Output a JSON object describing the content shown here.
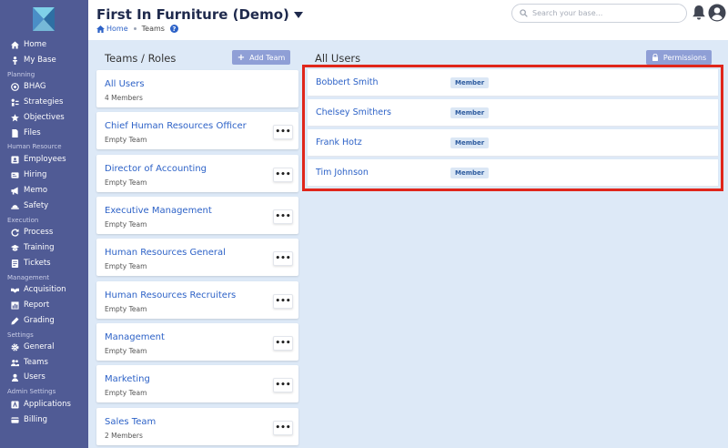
{
  "header": {
    "app_title": "First In Furniture (Demo)",
    "breadcrumb_home": "Home",
    "breadcrumb_current": "Teams",
    "help": "?",
    "search_placeholder": "Search your base..."
  },
  "sidebar": {
    "items": [
      {
        "label": "Home",
        "icon": "home-icon"
      },
      {
        "label": "My Base",
        "icon": "person-icon"
      }
    ],
    "section_planning": "Planning",
    "planning": [
      {
        "label": "BHAG",
        "icon": "target-icon"
      },
      {
        "label": "Strategies",
        "icon": "strategy-icon"
      },
      {
        "label": "Objectives",
        "icon": "star-icon"
      },
      {
        "label": "Files",
        "icon": "file-icon"
      }
    ],
    "section_hr": "Human Resource",
    "hr": [
      {
        "label": "Employees",
        "icon": "id-card-icon"
      },
      {
        "label": "Hiring",
        "icon": "hiring-icon"
      },
      {
        "label": "Memo",
        "icon": "megaphone-icon"
      },
      {
        "label": "Safety",
        "icon": "hardhat-icon"
      }
    ],
    "section_execution": "Execution",
    "execution": [
      {
        "label": "Process",
        "icon": "refresh-icon"
      },
      {
        "label": "Training",
        "icon": "graduation-cap-icon"
      },
      {
        "label": "Tickets",
        "icon": "ticket-icon"
      }
    ],
    "section_management": "Management",
    "management": [
      {
        "label": "Acquisition",
        "icon": "handshake-icon"
      },
      {
        "label": "Report",
        "icon": "report-icon"
      },
      {
        "label": "Grading",
        "icon": "pen-icon"
      }
    ],
    "section_settings": "Settings",
    "settings": [
      {
        "label": "General",
        "icon": "gear-icon"
      },
      {
        "label": "Teams",
        "icon": "users-icon"
      },
      {
        "label": "Users",
        "icon": "user-icon"
      }
    ],
    "section_admin": "Admin Settings",
    "admin": [
      {
        "label": "Applications",
        "icon": "apps-icon"
      },
      {
        "label": "Billing",
        "icon": "billing-icon"
      }
    ]
  },
  "teams_panel": {
    "title": "Teams / Roles",
    "add_button": "Add Team",
    "teams": [
      {
        "name": "All Users",
        "sub": "4 Members"
      },
      {
        "name": "Chief Human Resources Officer",
        "sub": "Empty Team"
      },
      {
        "name": "Director of Accounting",
        "sub": "Empty Team"
      },
      {
        "name": "Executive Management",
        "sub": "Empty Team"
      },
      {
        "name": "Human Resources General",
        "sub": "Empty Team"
      },
      {
        "name": "Human Resources Recruiters",
        "sub": "Empty Team"
      },
      {
        "name": "Management",
        "sub": "Empty Team"
      },
      {
        "name": "Marketing",
        "sub": "Empty Team"
      },
      {
        "name": "Sales Team",
        "sub": "2 Members"
      }
    ],
    "more_label": "•••"
  },
  "users_panel": {
    "title": "All Users",
    "permissions_button": "Permissions",
    "users": [
      {
        "name": "Bobbert Smith",
        "role": "Member"
      },
      {
        "name": "Chelsey Smithers",
        "role": "Member"
      },
      {
        "name": "Frank Hotz",
        "role": "Member"
      },
      {
        "name": "Tim Johnson",
        "role": "Member"
      }
    ]
  },
  "colors": {
    "sidebar": "#505b95",
    "accent": "#2d62c7",
    "highlight": "#e0261b",
    "background": "#dde9f7"
  }
}
